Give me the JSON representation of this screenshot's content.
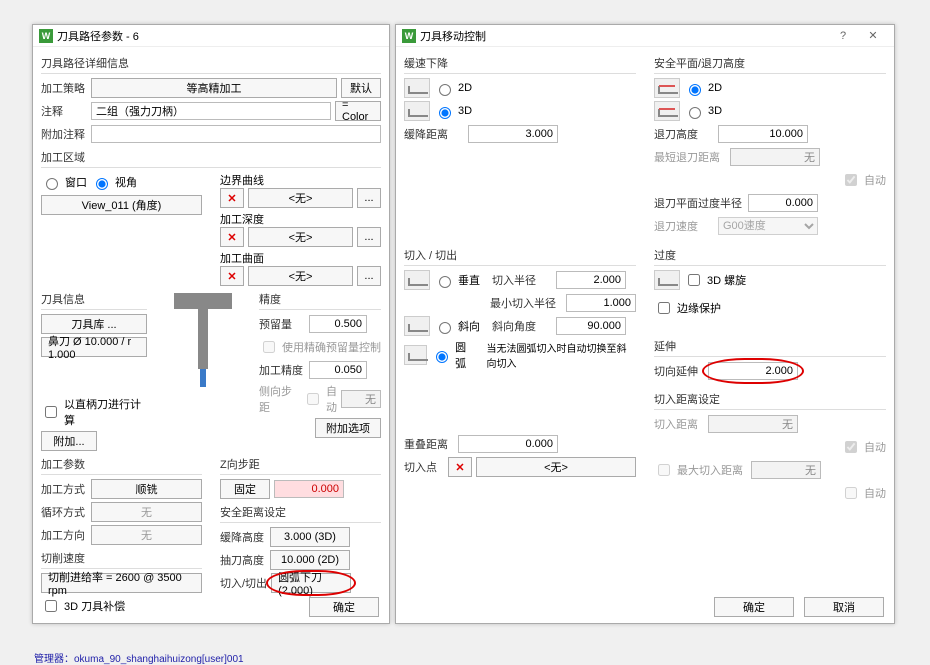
{
  "left": {
    "title": "刀具路径参数 - 6",
    "sec_detail": "刀具路径详细信息",
    "strategy_lbl": "加工策略",
    "strategy_btn": "等高精加工",
    "default_btn": "默认",
    "comment_lbl": "注释",
    "comment_val": "二组（强力刀柄）",
    "color_btn": "= Color",
    "addcomment_lbl": "附加注释",
    "sec_area": "加工区域",
    "area_window": "窗口",
    "area_view": "视角",
    "view_btn": "View_011 (角度)",
    "bound_lbl": "边界曲线",
    "none_lbl": "<无>",
    "depth_lbl": "加工深度",
    "surf_lbl": "加工曲面",
    "sec_tool": "刀具信息",
    "toollib_btn": "刀具库 ...",
    "tool_desc": "鼻刀 Ø 10.000 / r 1.000",
    "straight_calc": "以直柄刀进行计算",
    "attach_btn": "附加...",
    "sec_params": "加工参数",
    "method_lbl": "加工方式",
    "method_val": "顺铣",
    "loop_lbl": "循环方式",
    "loop_val": "无",
    "dir_lbl": "加工方向",
    "dir_val": "无",
    "sec_speed": "切削速度",
    "speed_btn": "切削进给率 = 2600 @ 3500 rpm",
    "comp3d_lbl": "3D 刀具补偿",
    "sec_prec": "精度",
    "allow_lbl": "预留量",
    "allow_val": "0.500",
    "precise_allow": "使用精确预留量控制",
    "machprec_lbl": "加工精度",
    "machprec_val": "0.050",
    "lateral_lbl": "侧向步距",
    "auto_lbl": "自动",
    "attach_opt_btn": "附加选项",
    "sec_zstep": "Z向步距",
    "fixed_btn": "固定",
    "fixed_val": "0.000",
    "sec_safe": "安全距离设定",
    "retract_lbl": "缓降高度",
    "retract_val": "3.000 (3D)",
    "plunge_lbl": "抽刀高度",
    "plunge_val": "10.000 (2D)",
    "inout_lbl": "切入/切出",
    "inout_val": "圆弧下刀(2.000)",
    "ok_btn": "确定"
  },
  "right": {
    "title": "刀具移动控制",
    "sec_slow": "缓速下降",
    "r2d": "2D",
    "r3d": "3D",
    "slowdist_lbl": "缓降距离",
    "slowdist_val": "3.000",
    "sec_safe": "安全平面/退刀高度",
    "retractH_lbl": "退刀高度",
    "retractH_val": "10.000",
    "minretract_lbl": "最短退刀距离",
    "minretract_val": "无",
    "auto_lbl": "自动",
    "planeR_lbl": "退刀平面过度半径",
    "planeR_val": "0.000",
    "retractspeed_lbl": "退刀速度",
    "retractspeed_val": "G00速度",
    "sec_inout": "切入 / 切出",
    "vert_lbl": "垂直",
    "diag_lbl": "斜向",
    "arc_lbl": "圆弧",
    "inR_lbl": "切入半径",
    "inR_val": "2.000",
    "minR_lbl": "最小切入半径",
    "minR_val": "1.000",
    "angle_lbl": "斜向角度",
    "angle_val": "90.000",
    "arc_note": "当无法圆弧切入时自动切换至斜向切入",
    "overlap_lbl": "重叠距离",
    "overlap_val": "0.000",
    "inpoint_lbl": "切入点",
    "sec_trans": "过度",
    "helix_lbl": "3D 螺旋",
    "edge_lbl": "边缘保护",
    "sec_ext": "延伸",
    "tangext_lbl": "切向延伸",
    "tangext_val": "2.000",
    "sec_dist": "切入距离设定",
    "indist_lbl": "切入距离",
    "indist_val": "无",
    "maxdist_lbl": "最大切入距离",
    "maxdist_val": "无",
    "ok_btn": "确定",
    "cancel_btn": "取消"
  },
  "status": "管理器：okuma_90_shanghaihuizong[user]001"
}
